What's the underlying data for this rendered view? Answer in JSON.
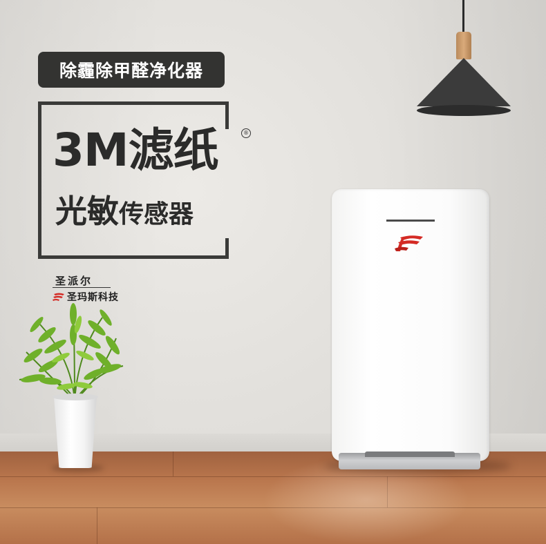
{
  "promo": {
    "badge": "除霾除甲醛净化器",
    "headline_line1": "3M滤纸",
    "headline_line2_big": "光敏",
    "headline_line2_small": "传感器",
    "registered_symbol": "®"
  },
  "brand": {
    "script_name": "圣派尔",
    "company_name": "圣玛斯科技"
  },
  "colors": {
    "badge_bg": "#333331",
    "text_dark": "#2b2b2a",
    "logo_red": "#d42a24",
    "wall": "#e4e2de",
    "floor": "#b9764d"
  },
  "icons": {
    "brand_logo": "stylized-red-f-logo",
    "pendant_lamp": "black-cone-lamp",
    "plant": "potted-palm"
  }
}
